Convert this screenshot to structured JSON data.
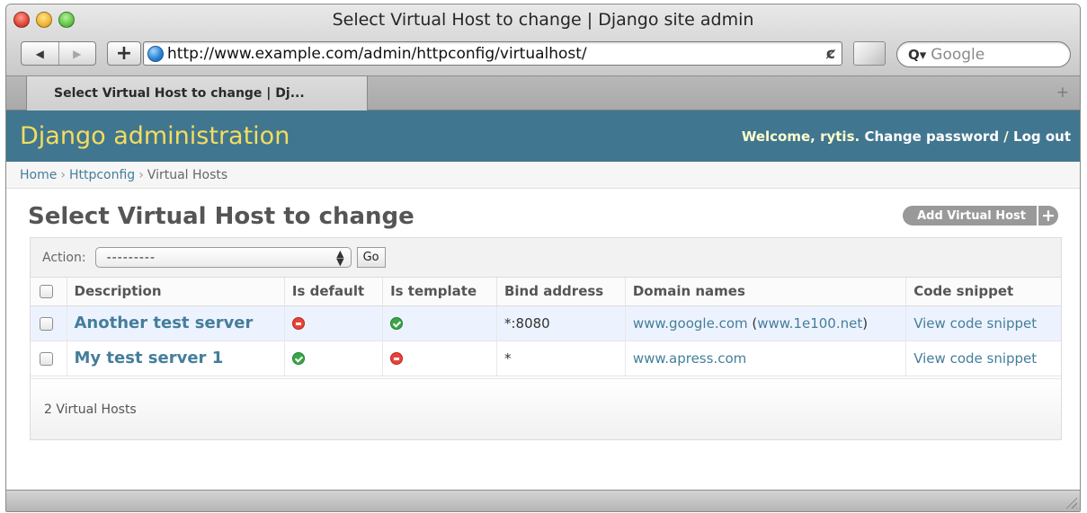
{
  "window": {
    "title": "Select Virtual Host to change | Django site admin"
  },
  "toolbar": {
    "back_glyph": "◀",
    "forward_glyph": "▶",
    "add_glyph": "+",
    "url": "http://www.example.com/admin/httpconfig/virtualhost/",
    "reload_glyph": "ȼ",
    "search_icon_glyph": "Q▾",
    "search_placeholder": "Google"
  },
  "tabs": {
    "active_label": "Select Virtual Host to change | Dj...",
    "new_tab_glyph": "+"
  },
  "header": {
    "brand": "Django administration",
    "welcome_prefix": "Welcome, ",
    "username": "rytis",
    "welcome_suffix": ".",
    "change_password": "Change password",
    "separator": " / ",
    "logout": "Log out"
  },
  "breadcrumb": {
    "home": "Home",
    "sep": "›",
    "app": "Httpconfig",
    "current": "Virtual Hosts"
  },
  "page": {
    "title": "Select Virtual Host to change",
    "add_label": "Add Virtual Host",
    "add_glyph": "+"
  },
  "actions": {
    "label": "Action:",
    "selected": "---------",
    "go": "Go"
  },
  "table": {
    "headers": [
      "Description",
      "Is default",
      "Is template",
      "Bind address",
      "Domain names",
      "Code snippet"
    ],
    "rows": [
      {
        "description": "Another test server",
        "is_default": false,
        "is_template": true,
        "bind_address": "*:8080",
        "domain_primary": "www.google.com",
        "domain_open": " (",
        "domain_alias": "www.1e100.net",
        "domain_close": ")",
        "code_snippet": "View code snippet"
      },
      {
        "description": "My test server 1",
        "is_default": true,
        "is_template": false,
        "bind_address": "*",
        "domain_primary": "www.apress.com",
        "code_snippet": "View code snippet"
      }
    ]
  },
  "paginator": {
    "text": "2 Virtual Hosts"
  },
  "colors": {
    "header_bg": "#417690",
    "brand_text": "#f5dd5d",
    "link": "#447e9b",
    "row_highlight": "#edf3fe",
    "yes_icon": "#3aa648",
    "no_icon": "#e8433a"
  }
}
